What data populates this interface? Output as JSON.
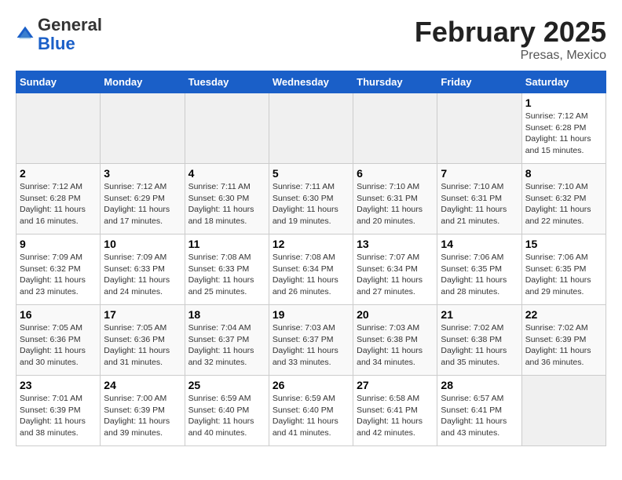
{
  "header": {
    "logo_general": "General",
    "logo_blue": "Blue",
    "calendar_title": "February 2025",
    "calendar_subtitle": "Presas, Mexico"
  },
  "days_of_week": [
    "Sunday",
    "Monday",
    "Tuesday",
    "Wednesday",
    "Thursday",
    "Friday",
    "Saturday"
  ],
  "weeks": [
    [
      {
        "num": "",
        "info": ""
      },
      {
        "num": "",
        "info": ""
      },
      {
        "num": "",
        "info": ""
      },
      {
        "num": "",
        "info": ""
      },
      {
        "num": "",
        "info": ""
      },
      {
        "num": "",
        "info": ""
      },
      {
        "num": "1",
        "info": "Sunrise: 7:12 AM\nSunset: 6:28 PM\nDaylight: 11 hours\nand 15 minutes."
      }
    ],
    [
      {
        "num": "2",
        "info": "Sunrise: 7:12 AM\nSunset: 6:28 PM\nDaylight: 11 hours\nand 16 minutes."
      },
      {
        "num": "3",
        "info": "Sunrise: 7:12 AM\nSunset: 6:29 PM\nDaylight: 11 hours\nand 17 minutes."
      },
      {
        "num": "4",
        "info": "Sunrise: 7:11 AM\nSunset: 6:30 PM\nDaylight: 11 hours\nand 18 minutes."
      },
      {
        "num": "5",
        "info": "Sunrise: 7:11 AM\nSunset: 6:30 PM\nDaylight: 11 hours\nand 19 minutes."
      },
      {
        "num": "6",
        "info": "Sunrise: 7:10 AM\nSunset: 6:31 PM\nDaylight: 11 hours\nand 20 minutes."
      },
      {
        "num": "7",
        "info": "Sunrise: 7:10 AM\nSunset: 6:31 PM\nDaylight: 11 hours\nand 21 minutes."
      },
      {
        "num": "8",
        "info": "Sunrise: 7:10 AM\nSunset: 6:32 PM\nDaylight: 11 hours\nand 22 minutes."
      }
    ],
    [
      {
        "num": "9",
        "info": "Sunrise: 7:09 AM\nSunset: 6:32 PM\nDaylight: 11 hours\nand 23 minutes."
      },
      {
        "num": "10",
        "info": "Sunrise: 7:09 AM\nSunset: 6:33 PM\nDaylight: 11 hours\nand 24 minutes."
      },
      {
        "num": "11",
        "info": "Sunrise: 7:08 AM\nSunset: 6:33 PM\nDaylight: 11 hours\nand 25 minutes."
      },
      {
        "num": "12",
        "info": "Sunrise: 7:08 AM\nSunset: 6:34 PM\nDaylight: 11 hours\nand 26 minutes."
      },
      {
        "num": "13",
        "info": "Sunrise: 7:07 AM\nSunset: 6:34 PM\nDaylight: 11 hours\nand 27 minutes."
      },
      {
        "num": "14",
        "info": "Sunrise: 7:06 AM\nSunset: 6:35 PM\nDaylight: 11 hours\nand 28 minutes."
      },
      {
        "num": "15",
        "info": "Sunrise: 7:06 AM\nSunset: 6:35 PM\nDaylight: 11 hours\nand 29 minutes."
      }
    ],
    [
      {
        "num": "16",
        "info": "Sunrise: 7:05 AM\nSunset: 6:36 PM\nDaylight: 11 hours\nand 30 minutes."
      },
      {
        "num": "17",
        "info": "Sunrise: 7:05 AM\nSunset: 6:36 PM\nDaylight: 11 hours\nand 31 minutes."
      },
      {
        "num": "18",
        "info": "Sunrise: 7:04 AM\nSunset: 6:37 PM\nDaylight: 11 hours\nand 32 minutes."
      },
      {
        "num": "19",
        "info": "Sunrise: 7:03 AM\nSunset: 6:37 PM\nDaylight: 11 hours\nand 33 minutes."
      },
      {
        "num": "20",
        "info": "Sunrise: 7:03 AM\nSunset: 6:38 PM\nDaylight: 11 hours\nand 34 minutes."
      },
      {
        "num": "21",
        "info": "Sunrise: 7:02 AM\nSunset: 6:38 PM\nDaylight: 11 hours\nand 35 minutes."
      },
      {
        "num": "22",
        "info": "Sunrise: 7:02 AM\nSunset: 6:39 PM\nDaylight: 11 hours\nand 36 minutes."
      }
    ],
    [
      {
        "num": "23",
        "info": "Sunrise: 7:01 AM\nSunset: 6:39 PM\nDaylight: 11 hours\nand 38 minutes."
      },
      {
        "num": "24",
        "info": "Sunrise: 7:00 AM\nSunset: 6:39 PM\nDaylight: 11 hours\nand 39 minutes."
      },
      {
        "num": "25",
        "info": "Sunrise: 6:59 AM\nSunset: 6:40 PM\nDaylight: 11 hours\nand 40 minutes."
      },
      {
        "num": "26",
        "info": "Sunrise: 6:59 AM\nSunset: 6:40 PM\nDaylight: 11 hours\nand 41 minutes."
      },
      {
        "num": "27",
        "info": "Sunrise: 6:58 AM\nSunset: 6:41 PM\nDaylight: 11 hours\nand 42 minutes."
      },
      {
        "num": "28",
        "info": "Sunrise: 6:57 AM\nSunset: 6:41 PM\nDaylight: 11 hours\nand 43 minutes."
      },
      {
        "num": "",
        "info": ""
      }
    ]
  ]
}
